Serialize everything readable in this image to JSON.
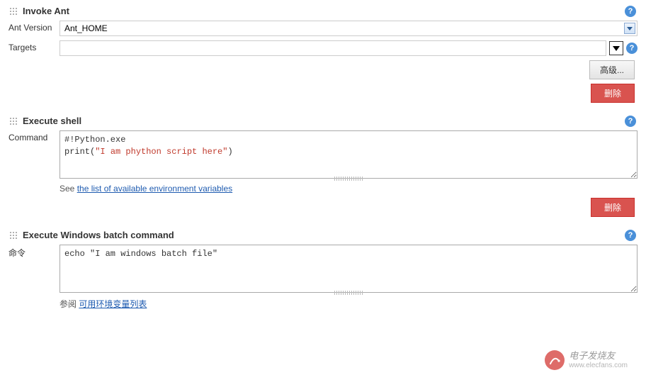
{
  "sections": {
    "invoke_ant": {
      "title": "Invoke Ant",
      "ant_version_label": "Ant Version",
      "ant_version_value": "Ant_HOME",
      "targets_label": "Targets",
      "targets_value": "",
      "advanced_btn": "高级...",
      "delete_btn": "删除"
    },
    "execute_shell": {
      "title": "Execute shell",
      "command_label": "Command",
      "command_line1": "#!Python.exe",
      "command_line2_prefix": "print(",
      "command_line2_string": "\"I am phython script here\"",
      "command_line2_suffix": ")",
      "hint_prefix": "See ",
      "hint_link": "the list of available environment variables",
      "delete_btn": "删除"
    },
    "execute_batch": {
      "title": "Execute Windows batch command",
      "command_label": "命令",
      "command_value": "echo \"I am windows batch file\"",
      "hint_prefix": "参阅 ",
      "hint_link": "可用环境变量列表",
      "delete_btn": "删除"
    }
  },
  "watermark": {
    "title": "电子发烧友",
    "url": "www.elecfans.com"
  }
}
